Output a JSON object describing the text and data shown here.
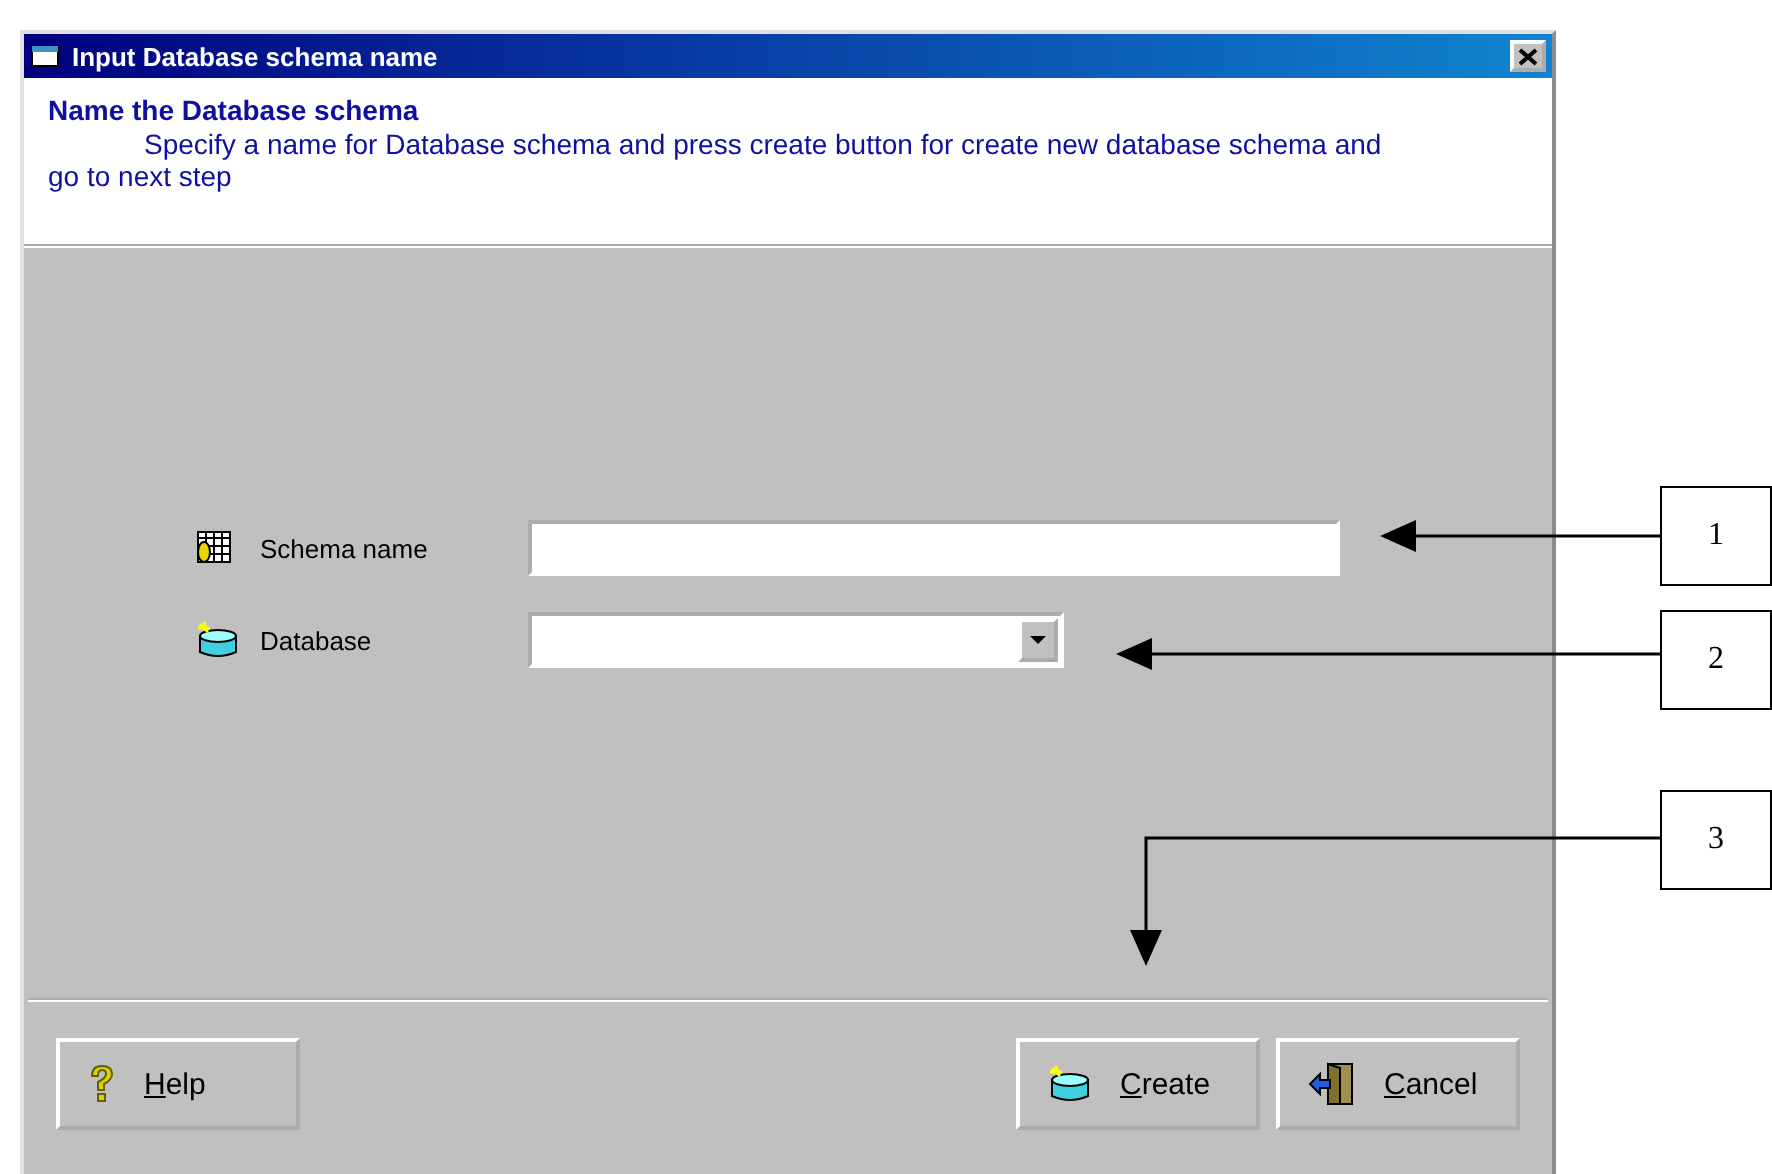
{
  "window": {
    "title": "Input Database schema name"
  },
  "header": {
    "title": "Name the Database schema",
    "description": "Specify a name for Database schema and press create button for create new database schema and go to next step"
  },
  "fields": [
    {
      "kind": "text",
      "label": "Schema name"
    },
    {
      "kind": "dropdown",
      "label": "Database"
    }
  ],
  "buttons": [
    {
      "label": "Help",
      "first_letter_underlined": true
    },
    {
      "label": "Create",
      "first_letter_underlined": true
    },
    {
      "label": "Cancel",
      "first_letter_underlined": true
    }
  ],
  "callouts": [
    {
      "number": "1"
    },
    {
      "number": "2"
    },
    {
      "number": "3"
    }
  ]
}
